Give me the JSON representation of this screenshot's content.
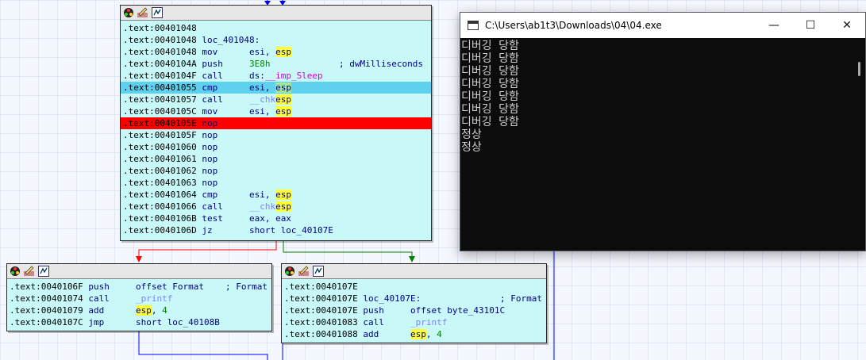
{
  "colors": {
    "node_bg": "#c8f8f8",
    "highlight_blue": "#5fd0ee",
    "highlight_red": "#ff0000",
    "edge_true": "#ff0000",
    "edge_false": "#008000",
    "edge_normal": "#0000ff"
  },
  "header_icons": [
    "color-palette-icon",
    "rename-icon",
    "graph-view-icon"
  ],
  "main_block": {
    "lines": [
      {
        "addr": ".text:00401048",
        "mn": "",
        "op": "",
        "hl": ""
      },
      {
        "addr": ".text:00401048",
        "mn": "loc_401048:",
        "op": "",
        "hl": ""
      },
      {
        "addr": ".text:00401048",
        "mn": "mov",
        "op1": "esi, ",
        "reg": "esp",
        "hl": ""
      },
      {
        "addr": ".text:0040104A",
        "mn": "push",
        "imm": "3E8h",
        "comment": "; dwMilliseconds",
        "hl": ""
      },
      {
        "addr": ".text:0040104F",
        "mn": "call",
        "op1": "ds:",
        "ext": "__imp_Sleep",
        "hl": ""
      },
      {
        "addr": ".text:00401055",
        "mn": "cmp",
        "op1": "esi, ",
        "reg": "esp",
        "hl": "blue"
      },
      {
        "addr": ".text:00401057",
        "mn": "call",
        "func": "__chk",
        "reg": "esp",
        "hl": ""
      },
      {
        "addr": ".text:0040105C",
        "mn": "mov",
        "op1": "esi, ",
        "reg": "esp",
        "hl": ""
      },
      {
        "addr": ".text:0040105E",
        "mn": "nop",
        "hl": "red"
      },
      {
        "addr": ".text:0040105F",
        "mn": "nop",
        "hl": ""
      },
      {
        "addr": ".text:00401060",
        "mn": "nop",
        "hl": ""
      },
      {
        "addr": ".text:00401061",
        "mn": "nop",
        "hl": ""
      },
      {
        "addr": ".text:00401062",
        "mn": "nop",
        "hl": ""
      },
      {
        "addr": ".text:00401063",
        "mn": "nop",
        "hl": ""
      },
      {
        "addr": ".text:00401064",
        "mn": "cmp",
        "op1": "esi, ",
        "reg": "esp",
        "hl": ""
      },
      {
        "addr": ".text:00401066",
        "mn": "call",
        "func": "__chk",
        "reg": "esp",
        "hl": ""
      },
      {
        "addr": ".text:0040106B",
        "mn": "test",
        "op1": "eax, eax",
        "hl": ""
      },
      {
        "addr": ".text:0040106D",
        "mn": "jz",
        "op1": "short loc_40107E",
        "hl": ""
      }
    ]
  },
  "left_block": {
    "lines": [
      {
        "addr": ".text:0040106F",
        "mn": "push",
        "op1": "offset Format",
        "comment": "; Format"
      },
      {
        "addr": ".text:00401074",
        "mn": "call",
        "func": "_printf"
      },
      {
        "addr": ".text:00401079",
        "mn": "add",
        "reg": "esp",
        "op2": ", ",
        "imm": "4"
      },
      {
        "addr": ".text:0040107C",
        "mn": "jmp",
        "op1": "short loc_40108B"
      }
    ]
  },
  "right_block": {
    "lines": [
      {
        "addr": ".text:0040107E",
        "mn": ""
      },
      {
        "addr": ".text:0040107E",
        "mn": "loc_40107E:",
        "comment": "; Format"
      },
      {
        "addr": ".text:0040107E",
        "mn": "push",
        "op1": "offset byte_43101C"
      },
      {
        "addr": ".text:00401083",
        "mn": "call",
        "func": "_printf"
      },
      {
        "addr": ".text:00401088",
        "mn": "add",
        "reg": "esp",
        "op2": ", ",
        "imm": "4"
      }
    ]
  },
  "console": {
    "title": "C:\\Users\\ab1t3\\Downloads\\04\\04.exe",
    "minimize": "—",
    "maximize": "☐",
    "close": "✕",
    "output": [
      "디버깅 당함",
      "디버깅 당함",
      "디버깅 당함",
      "디버깅 당함",
      "디버깅 당함",
      "디버깅 당함",
      "디버깅 당함",
      "정상",
      "정상"
    ]
  }
}
